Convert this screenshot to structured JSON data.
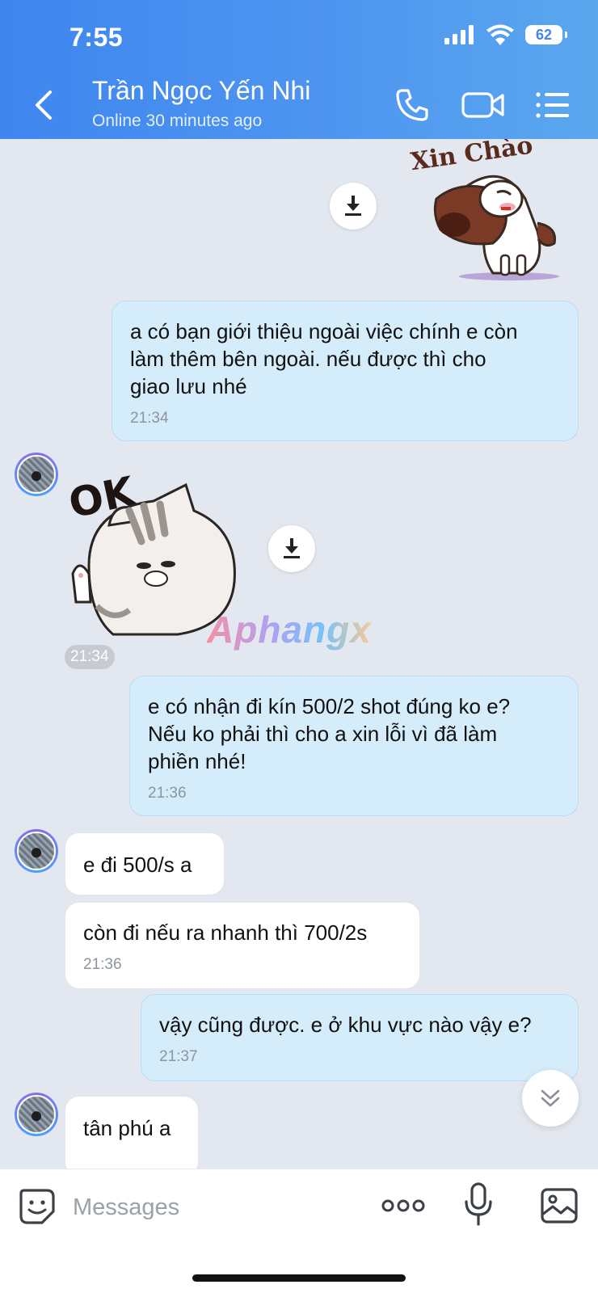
{
  "status_bar": {
    "time": "7:55",
    "battery": "62"
  },
  "header": {
    "contact_name": "Trần Ngọc Yến Nhi",
    "contact_status": "Online 30 minutes ago",
    "icons": [
      "back-icon",
      "phone-icon",
      "video-icon",
      "menu-list-icon"
    ]
  },
  "messages": [
    {
      "type": "sticker",
      "side": "out",
      "sticker": "dog-xin-chao",
      "caption": "Xin Chào"
    },
    {
      "type": "text",
      "side": "out",
      "text": "a có bạn giới thiệu ngoài việc chính e còn\nlàm thêm bên ngoài. nếu được thì cho\ngiao lưu nhé",
      "time": "21:34"
    },
    {
      "type": "sticker",
      "side": "in",
      "sticker": "cat-ok",
      "caption": "OK",
      "time": "21:34"
    },
    {
      "type": "text",
      "side": "out",
      "text": "e có nhận đi kín 500/2 shot đúng ko e?\nNếu ko phải thì cho a xin lỗi vì đã làm\nphiền nhé!",
      "time": "21:36"
    },
    {
      "type": "text",
      "side": "in",
      "text": "e đi 500/s a"
    },
    {
      "type": "text",
      "side": "in",
      "text": "còn đi nếu ra nhanh thì 700/2s",
      "time": "21:36"
    },
    {
      "type": "text",
      "side": "out",
      "text": "vậy cũng được. e ở khu vực nào vậy e?",
      "time": "21:37"
    },
    {
      "type": "text",
      "side": "in",
      "text": "tân phú a"
    }
  ],
  "watermark": "Aphangx",
  "composer": {
    "placeholder": "Messages"
  },
  "colors": {
    "header": "#4a90f0",
    "out_bubble": "#d5ecfb",
    "in_bubble": "#ffffff",
    "chat_bg": "#e3e8f0"
  }
}
